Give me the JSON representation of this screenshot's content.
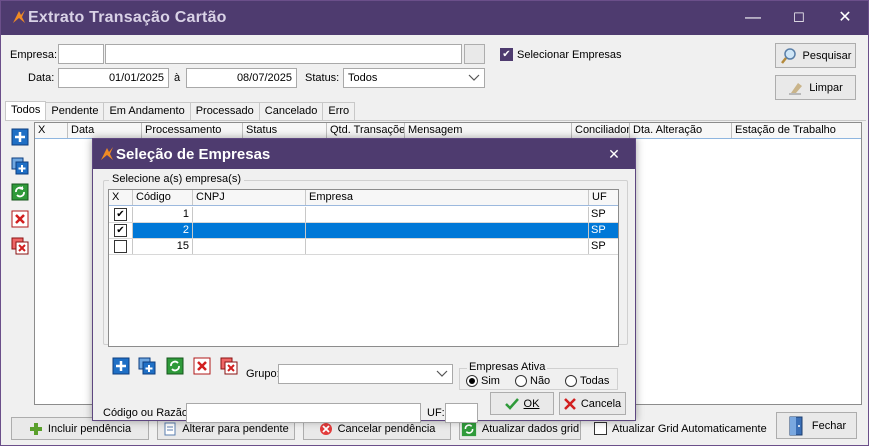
{
  "window": {
    "title": "Extrato Transação Cartão",
    "minimize": "—",
    "maximize": "☐",
    "close": "✕",
    "accent": "#4e3b6f"
  },
  "filters": {
    "empresa_label": "Empresa:",
    "empresa_code": "",
    "empresa_name": "",
    "selecionar_empresas": "Selecionar Empresas",
    "data_label": "Data:",
    "data_from": "01/01/2025",
    "data_sep": "à",
    "data_to": "08/07/2025",
    "status_label": "Status:",
    "status_value": "Todos",
    "pesquisar": "Pesquisar",
    "limpar": "Limpar"
  },
  "tabs": [
    "Todos",
    "Pendente",
    "Em Andamento",
    "Processado",
    "Cancelado",
    "Erro"
  ],
  "grid": {
    "columns": [
      "X",
      "Data",
      "Processamento",
      "Status",
      "Qtd. Transações",
      "Mensagem",
      "Conciliadora",
      "Dta. Alteração",
      "Estação de Trabalho"
    ]
  },
  "bottom": {
    "incluir": "Incluir pendência",
    "alterar": "Alterar para pendente",
    "cancelar": "Cancelar pendência",
    "atualizar": "Atualizar dados grid",
    "auto": "Atualizar Grid Automaticamente",
    "fechar": "Fechar"
  },
  "dialog": {
    "title": "Seleção de Empresas",
    "close": "✕",
    "legend": "Selecione a(s) empresa(s)",
    "columns": [
      "X",
      "Código",
      "CNPJ",
      "Empresa",
      "UF"
    ],
    "rows": [
      {
        "checked": true,
        "codigo": "1",
        "cnpj": "",
        "empresa": "",
        "uf": "SP",
        "selected": false
      },
      {
        "checked": true,
        "codigo": "2",
        "cnpj": "",
        "empresa": "",
        "uf": "SP",
        "selected": true
      },
      {
        "checked": false,
        "codigo": "15",
        "cnpj": "",
        "empresa": "",
        "uf": "SP",
        "selected": false
      }
    ],
    "grupo_label": "Grupo:",
    "grupo_value": "",
    "ativa_legend": "Empresas Ativa",
    "ativa_sim": "Sim",
    "ativa_nao": "Não",
    "ativa_todas": "Todas",
    "codigo_label": "Código ou Razão:",
    "codigo_value": "",
    "uf_label": "UF:",
    "uf_value": "",
    "ok": "OK",
    "cancela": "Cancela"
  }
}
